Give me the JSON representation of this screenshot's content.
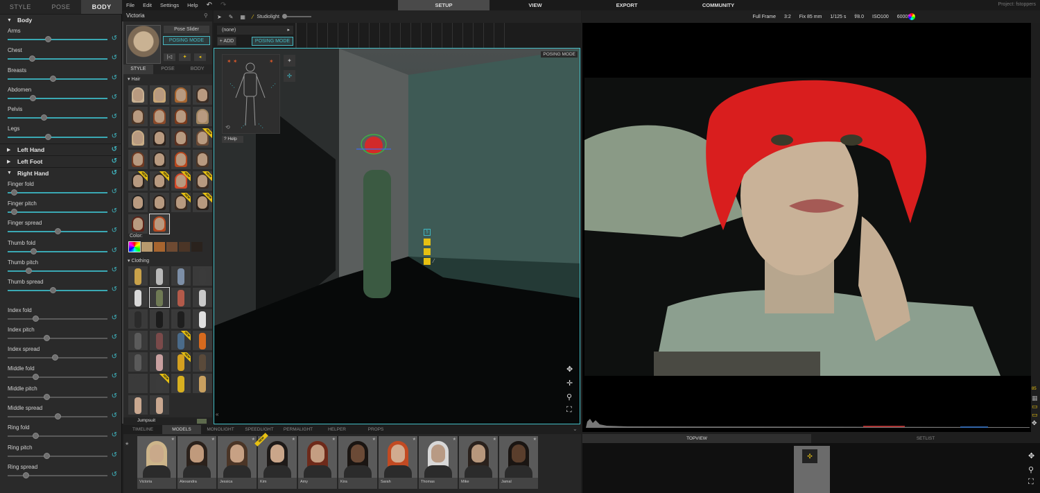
{
  "left_tabs": [
    "STYLE",
    "POSE",
    "BODY"
  ],
  "body_section": {
    "title": "Body",
    "sliders": [
      {
        "label": "Arms",
        "value": 0.4
      },
      {
        "label": "Chest",
        "value": 0.24
      },
      {
        "label": "Breasts",
        "value": 0.45
      },
      {
        "label": "Abdomen",
        "value": 0.25
      },
      {
        "label": "Pelvis",
        "value": 0.36
      },
      {
        "label": "Legs",
        "value": 0.4
      }
    ]
  },
  "collapsed_sections": [
    "Left Hand",
    "Left Foot"
  ],
  "right_hand_section": {
    "title": "Right Hand",
    "sliders": [
      {
        "label": "Finger fold",
        "value": 0.06
      },
      {
        "label": "Finger pitch",
        "value": 0.06
      },
      {
        "label": "Finger spread",
        "value": 0.5
      },
      {
        "label": "Thumb fold",
        "value": 0.26
      },
      {
        "label": "Thumb pitch",
        "value": 0.21
      },
      {
        "label": "Thumb spread",
        "value": 0.45
      }
    ],
    "finger_sliders": [
      {
        "label": "Index fold",
        "value": 0.28
      },
      {
        "label": "Index pitch",
        "value": 0.39
      },
      {
        "label": "Index spread",
        "value": 0.47
      },
      {
        "label": "Middle fold",
        "value": 0.28
      },
      {
        "label": "Middle pitch",
        "value": 0.39
      },
      {
        "label": "Middle spread",
        "value": 0.5
      },
      {
        "label": "Ring fold",
        "value": 0.28
      },
      {
        "label": "Ring pitch",
        "value": 0.39
      },
      {
        "label": "Ring spread",
        "value": 0.18
      }
    ]
  },
  "menu": [
    "File",
    "Edit",
    "Settings",
    "Help"
  ],
  "top_nav": [
    "SETUP",
    "VIEW",
    "EXPORT",
    "COMMUNITY"
  ],
  "project_label": "Project: fstoppers",
  "model_panel": {
    "name": "Victoria",
    "pose_slider_label": "Pose Slider",
    "posing_mode_label": "POSING MODE",
    "tabs": [
      "STYLE",
      "POSE",
      "BODY"
    ],
    "hair_label": "Hair",
    "color_label": "Color:",
    "clothing_label": "Clothing",
    "clothing_selected": "Jumpsuit",
    "new_badge": "NEW"
  },
  "toolbar": {
    "light_label": "Studiolight",
    "pose_select": "(none)",
    "add_label": "+ ADD",
    "posing_mode_label": "POSING MODE"
  },
  "viewport": {
    "posing_mode_badge": "POSING MODE",
    "help_label": "? Help"
  },
  "render_toolbar": [
    "Full Frame",
    "3:2",
    "Fix 85 mm",
    "1/125 s",
    "f/8.0",
    "ISO100",
    "6000K"
  ],
  "bottom_tabs": [
    "TIMELINE",
    "MODELS",
    "MONOLIGHT",
    "SPEEDLIGHT",
    "PERMALIGHT",
    "HELPER",
    "PROPS"
  ],
  "models": [
    "Victoria",
    "Alexandra",
    "Jessica",
    "Kim",
    "Amy",
    "Kira",
    "Sarah",
    "Thomas",
    "Mike",
    "Jamal"
  ],
  "topview_tabs": [
    "TOPVIEW",
    "SETLIST"
  ],
  "colors": {
    "accent": "#3fb7c2",
    "new_badge": "#e6c012",
    "hair_red": "#d91e1e"
  }
}
